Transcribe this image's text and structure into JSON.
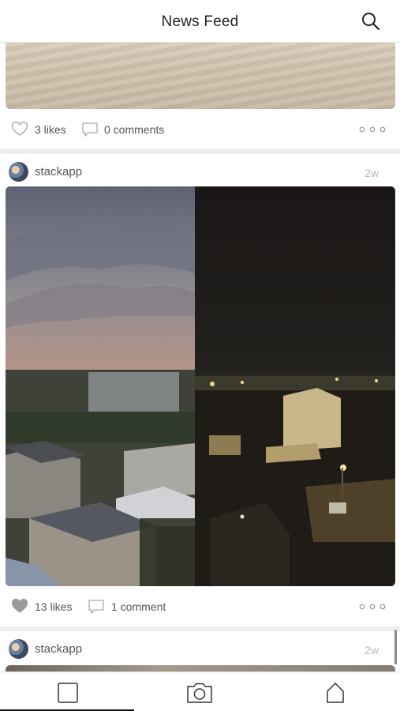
{
  "header": {
    "title": "News Feed",
    "search_icon": "search-icon"
  },
  "posts": [
    {
      "likes": "3 likes",
      "comments": "0 comments",
      "liked": false
    },
    {
      "username": "stackapp",
      "time": "2w",
      "likes": "13 likes",
      "comments": "1 comment",
      "liked": true
    },
    {
      "username": "stackapp",
      "time": "2w"
    }
  ],
  "tabbar": {
    "items": [
      "feed-icon",
      "camera-icon",
      "home-icon"
    ],
    "active": "feed-icon"
  },
  "colors": {
    "text": "#555555",
    "muted": "#b8b8b8",
    "background": "#efefef",
    "liked_heart": "#9a9a9a"
  }
}
